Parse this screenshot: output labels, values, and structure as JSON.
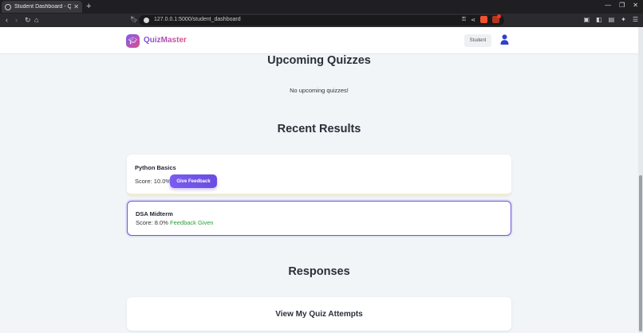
{
  "browser": {
    "tab_title": "Student Dashboard - Quiz",
    "url": "127.0.0.1:5000/student_dashboard"
  },
  "navbar": {
    "brand": "QuizMaster",
    "role_badge": "Student"
  },
  "upcoming": {
    "title": "Upcoming Quizzes",
    "empty_message": "No upcoming quizzes!"
  },
  "results": {
    "title": "Recent Results",
    "items": [
      {
        "quiz": "Python Basics",
        "score_label": "Score:",
        "score": "10.0%",
        "action_label": "Give Feedback"
      },
      {
        "quiz": "DSA Midterm",
        "score_label": "Score:",
        "score": "8.0%",
        "status": "Feedback Given"
      }
    ]
  },
  "responses": {
    "title": "Responses",
    "attempts_label": "View My Quiz Attempts"
  },
  "colors": {
    "accent": "#6b57d6",
    "success": "#2a9d3a",
    "page_bg": "#f1f5f8"
  },
  "icons": {
    "logo": "graduation-cap-icon",
    "user": "user-icon"
  }
}
